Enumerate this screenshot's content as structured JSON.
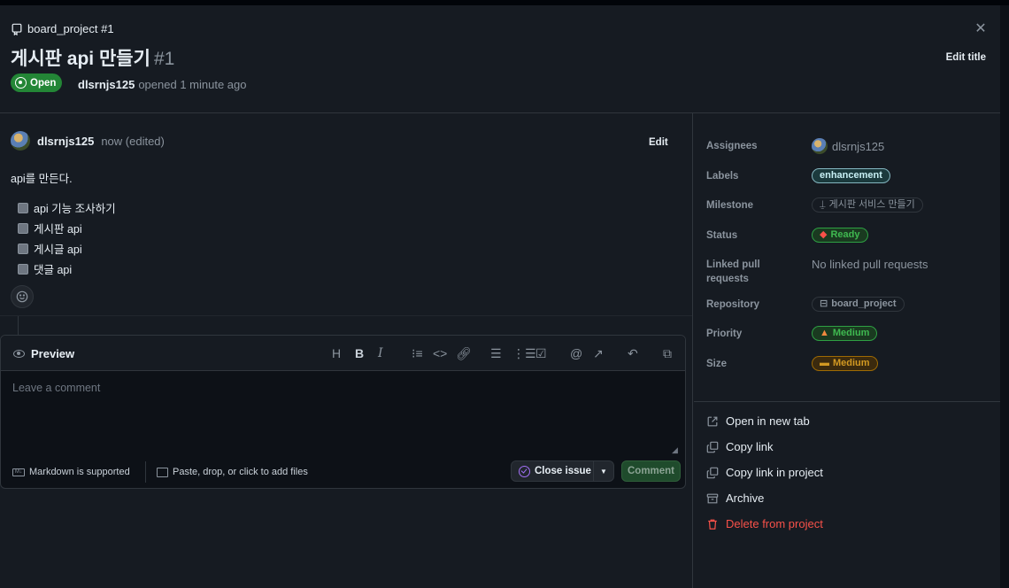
{
  "breadcrumb": {
    "text": "board_project #1",
    "icon": "repo-icon"
  },
  "issue": {
    "title": "게시판 api 만들기",
    "number": "#1",
    "state": "Open",
    "author": "dlsrnjs125",
    "opened_text": "opened 1 minute ago",
    "edit_title_label": "Edit title"
  },
  "comment": {
    "author": "dlsrnjs125",
    "meta": "now (edited)",
    "edit_label": "Edit",
    "body": "api를 만든다.",
    "tasks": [
      "api 기능 조사하기",
      "게시판 api",
      "게시글 api",
      "댓글 api"
    ]
  },
  "editor": {
    "tab_label": "Preview",
    "placeholder": "Leave a comment",
    "markdown_note": "Markdown is supported",
    "files_note": "Paste, drop, or click to add files",
    "close_issue_label": "Close issue",
    "comment_label": "Comment",
    "toolbar": [
      "heading-icon",
      "bold-icon",
      "italic-icon",
      "quote-icon",
      "code-icon",
      "link-icon",
      "unordered-list-icon",
      "ordered-list-icon",
      "task-list-icon",
      "mention-icon",
      "cross-reference-icon",
      "undo-icon",
      "fullscreen-icon"
    ]
  },
  "sidebar": {
    "assignees_label": "Assignees",
    "assignee": "dlsrnjs125",
    "labels_label": "Labels",
    "label_value": "enhancement",
    "milestone_label": "Milestone",
    "milestone_value": "게시판 서비스 만들기",
    "status_label": "Status",
    "status_value": "Ready",
    "linked_label": "Linked pull requests",
    "linked_value": "No linked pull requests",
    "repository_label": "Repository",
    "repository_value": "board_project",
    "priority_label": "Priority",
    "priority_value": "Medium",
    "size_label": "Size",
    "size_value": "Medium"
  },
  "actions": {
    "open_new_tab": "Open in new tab",
    "copy_link": "Copy link",
    "copy_link_project": "Copy link in project",
    "archive": "Archive",
    "delete": "Delete from project"
  },
  "colors": {
    "background": "#0d1117",
    "panel": "#161b22",
    "open_green": "#238636",
    "danger_red": "#f85149",
    "close_purple": "#a371f7"
  }
}
